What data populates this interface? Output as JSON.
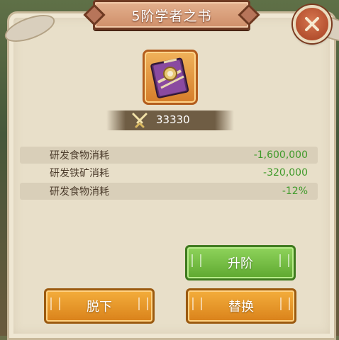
{
  "dialog": {
    "title": "5阶学者之书",
    "close_icon": "close-x-icon"
  },
  "item": {
    "icon": "book-icon",
    "power_icon": "crossed-swords-icon",
    "power_value": "33330"
  },
  "stats": [
    {
      "label": "研发食物消耗",
      "value": "-1,600,000"
    },
    {
      "label": "研发铁矿消耗",
      "value": "-320,000"
    },
    {
      "label": "研发食物消耗",
      "value": "-12%"
    }
  ],
  "buttons": {
    "upgrade": "升阶",
    "unequip": "脱下",
    "replace": "替换"
  },
  "colors": {
    "stat_value": "#3f9a2a",
    "upgrade_button": "#6fba3e",
    "action_button": "#e6951f",
    "title_banner": "#d79c78"
  }
}
